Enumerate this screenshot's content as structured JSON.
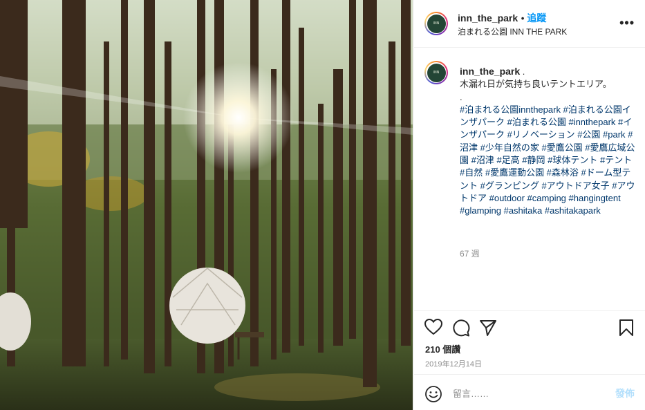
{
  "post": {
    "username": "inn_the_park",
    "follow_label": "追蹤",
    "location": "泊まれる公園 INN THE PARK",
    "more_icon": "more-horizontal-icon"
  },
  "caption": {
    "username": "inn_the_park",
    "dot": ".",
    "text": "木漏れ日が気持ち良いテントエリア。",
    "separator": ".",
    "hashtags": "#泊まれる公園innthepark #泊まれる公園インザパーク #泊まれる公園 #innthepark #インザパーク #リノベーション #公園 #park #沼津 #少年自然の家 #愛鷹公園 #愛鷹広域公園 #沼津 #足高 #静岡 #球体テント #テント #自然 #愛鷹運動公園 #森林浴 #ドーム型テント #グランピング #アウトドア女子 #アウトドア #outdoor #camping #hangingtent #glamping #ashitaka #ashitakapark",
    "time_ago": "67 週"
  },
  "actions": {
    "like_icon": "heart-icon",
    "comment_icon": "comment-icon",
    "share_icon": "share-icon",
    "save_icon": "bookmark-icon"
  },
  "stats": {
    "likes": "210 個讚",
    "date": "2019年12月14日"
  },
  "comment": {
    "emoji_icon": "emoji-icon",
    "placeholder": "留言……",
    "post_label": "發佈"
  }
}
